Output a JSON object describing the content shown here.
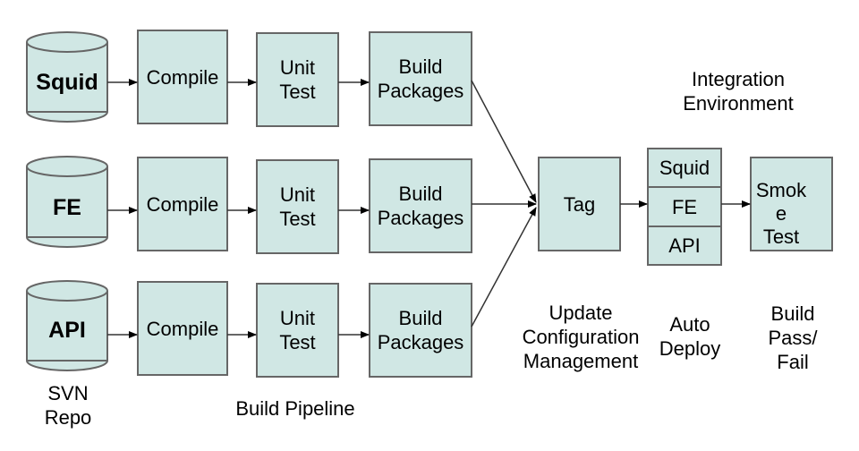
{
  "colors": {
    "box_fill": "#d0e7e4",
    "box_stroke": "#666666",
    "arrow": "#000000"
  },
  "repos": [
    {
      "label": "Squid"
    },
    {
      "label": "FE"
    },
    {
      "label": "API"
    }
  ],
  "pipeline_rows": [
    {
      "compile": "Compile",
      "unit_test": "Unit\nTest",
      "build_packages": "Build\nPackages"
    },
    {
      "compile": "Compile",
      "unit_test": "Unit\nTest",
      "build_packages": "Build\nPackages"
    },
    {
      "compile": "Compile",
      "unit_test": "Unit\nTest",
      "build_packages": "Build\nPackages"
    }
  ],
  "tag": "Tag",
  "deploy_stack": [
    "Squid",
    "FE",
    "API"
  ],
  "smoke_test": "Smok\ne\nTest",
  "captions": {
    "svn_repo": "SVN\nRepo",
    "build_pipeline": "Build Pipeline",
    "update_cm": "Update\nConfiguration\nManagement",
    "auto_deploy": "Auto\nDeploy",
    "build_pass_fail": "Build\nPass/\nFail",
    "integration_env": "Integration\nEnvironment"
  }
}
